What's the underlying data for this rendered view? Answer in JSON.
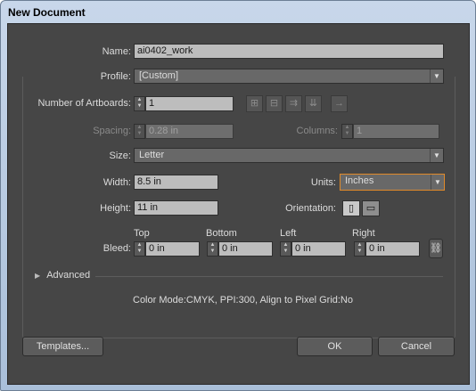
{
  "window": {
    "title": "New Document"
  },
  "name": {
    "label": "Name:",
    "value": "ai0402_work"
  },
  "profile": {
    "label": "Profile:",
    "value": "[Custom]"
  },
  "artboards": {
    "label": "Number of Artboards:",
    "value": "1",
    "icons": [
      "grid-by-row-icon",
      "grid-by-column-icon",
      "arrange-by-row-icon",
      "arrange-by-column-icon",
      "right-to-left-icon"
    ]
  },
  "spacing": {
    "label": "Spacing:",
    "value": "0.28 in"
  },
  "columns": {
    "label": "Columns:",
    "value": "1"
  },
  "size": {
    "label": "Size:",
    "value": "Letter"
  },
  "width": {
    "label": "Width:",
    "value": "8.5 in"
  },
  "units": {
    "label": "Units:",
    "value": "Inches"
  },
  "height": {
    "label": "Height:",
    "value": "11 in"
  },
  "orientation": {
    "label": "Orientation:",
    "selected": "portrait"
  },
  "bleed": {
    "label": "Bleed:",
    "top_label": "Top",
    "top_value": "0 in",
    "bottom_label": "Bottom",
    "bottom_value": "0 in",
    "left_label": "Left",
    "left_value": "0 in",
    "right_label": "Right",
    "right_value": "0 in",
    "linked": true
  },
  "advanced": {
    "label": "Advanced"
  },
  "info": {
    "text": "Color Mode:CMYK, PPI:300, Align to Pixel Grid:No"
  },
  "buttons": {
    "templates": "Templates...",
    "ok": "OK",
    "cancel": "Cancel"
  }
}
